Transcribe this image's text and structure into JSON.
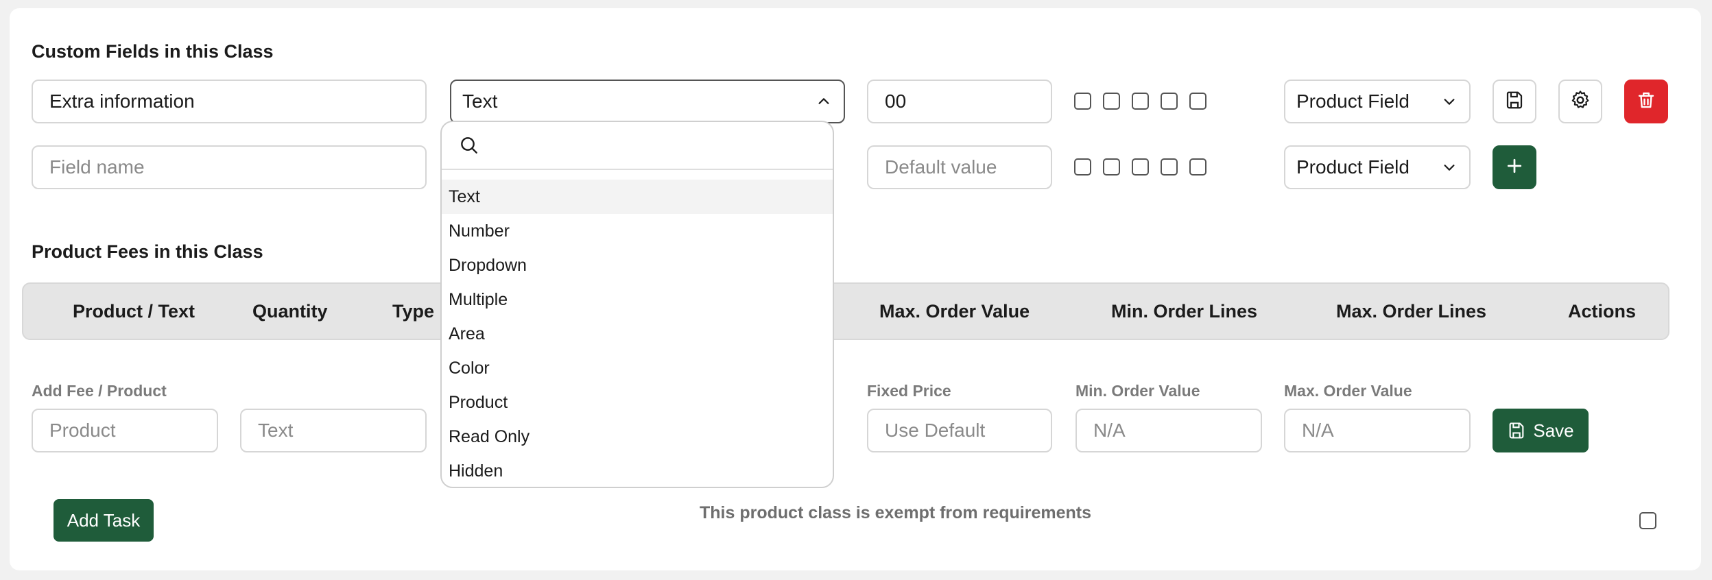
{
  "custom_fields": {
    "title": "Custom Fields in this Class",
    "row1": {
      "name_value": "Extra information",
      "type_value": "Text",
      "default_value": "00",
      "field_type": "Product Field"
    },
    "row2": {
      "name_placeholder": "Field name",
      "default_placeholder": "Default value",
      "field_type": "Product Field"
    }
  },
  "type_dropdown": {
    "search_placeholder": "",
    "options": [
      "Text",
      "Number",
      "Dropdown",
      "Multiple",
      "Area",
      "Color",
      "Product",
      "Read Only",
      "Hidden"
    ],
    "highlighted": "Text"
  },
  "product_fees": {
    "title": "Product Fees in this Class",
    "columns": [
      "Product / Text",
      "Quantity",
      "Type",
      "Max. Order Value",
      "Min. Order Lines",
      "Max. Order Lines",
      "Actions"
    ],
    "add_form": {
      "label_add": "Add Fee / Product",
      "product_placeholder": "Product",
      "text_placeholder": "Text",
      "label_fixed_price": "Fixed Price",
      "fixed_price_placeholder": "Use Default",
      "label_min_order": "Min. Order Value",
      "min_order_placeholder": "N/A",
      "label_max_order": "Max. Order Value",
      "max_order_placeholder": "N/A",
      "save_label": "Save"
    }
  },
  "footer": {
    "add_task_label": "Add Task",
    "exempt_text": "This product class is exempt from requirements"
  },
  "colors": {
    "primary_green": "#1f5c3a",
    "danger_red": "#e0262b"
  }
}
